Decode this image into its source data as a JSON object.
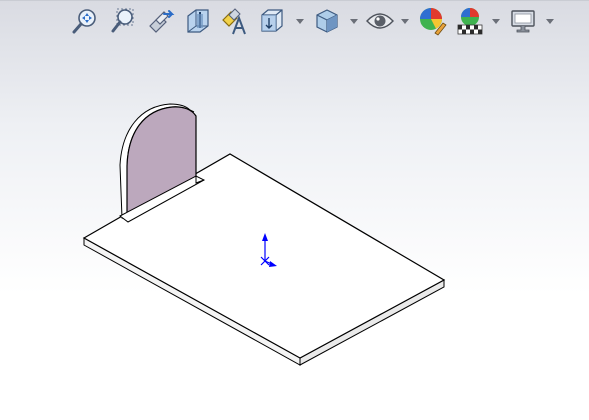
{
  "toolbar": {
    "items": [
      {
        "icon": "zoom-to-fit-icon",
        "has_dropdown": false
      },
      {
        "icon": "zoom-to-area-icon",
        "has_dropdown": false
      },
      {
        "icon": "previous-view-icon",
        "has_dropdown": false
      },
      {
        "icon": "section-view-icon",
        "has_dropdown": false
      },
      {
        "icon": "dynamic-annotation-views-icon",
        "has_dropdown": false
      },
      {
        "icon": "view-orientation-icon",
        "has_dropdown": true
      },
      {
        "icon": "display-style-icon",
        "has_dropdown": true
      },
      {
        "icon": "hide-show-items-icon",
        "has_dropdown": true
      },
      {
        "icon": "edit-appearance-icon",
        "has_dropdown": false
      },
      {
        "icon": "apply-scene-icon",
        "has_dropdown": true
      },
      {
        "icon": "view-settings-icon",
        "has_dropdown": true
      }
    ]
  },
  "model": {
    "base_plate_color": "#ffffff",
    "tab_color": "#bca8bd",
    "edge_color": "#000000",
    "triad_color": "#0000ff"
  }
}
